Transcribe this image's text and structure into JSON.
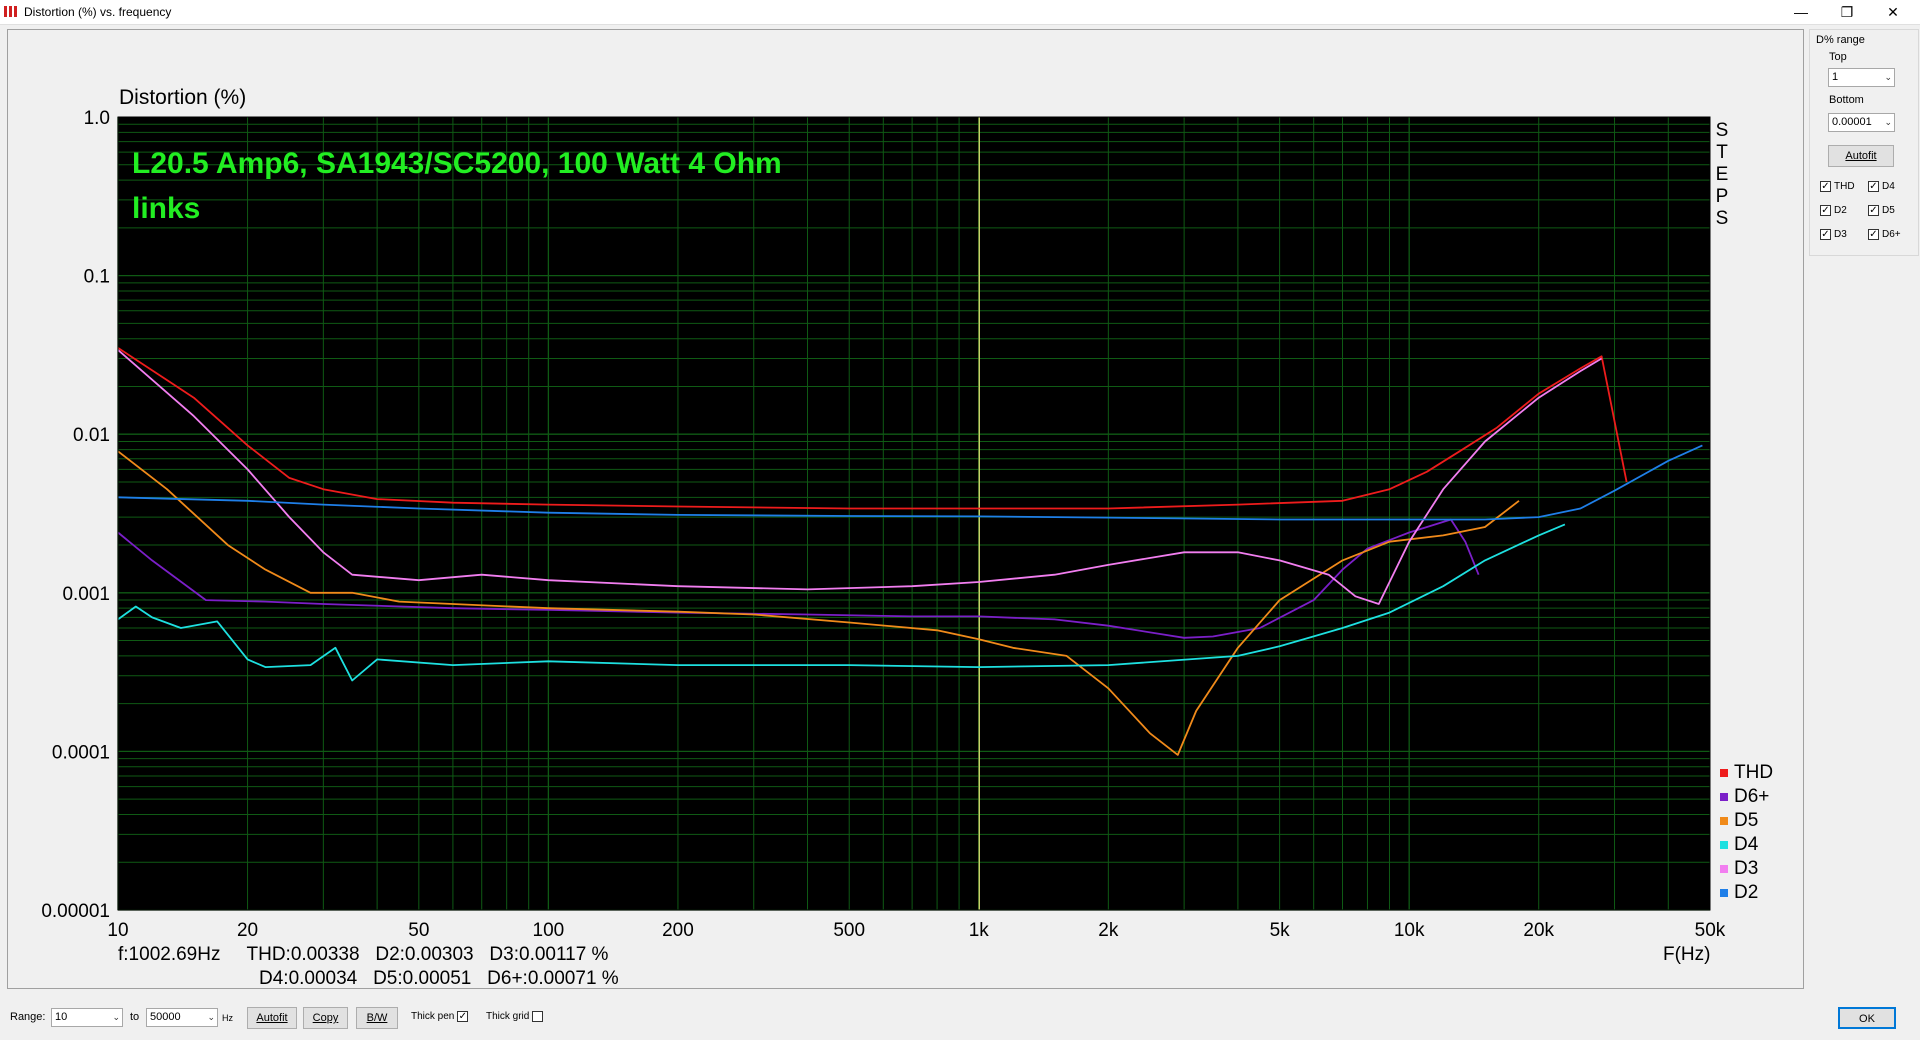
{
  "window": {
    "title": "Distortion (%) vs. frequency",
    "minimize": "—",
    "restore": "❐",
    "close": "✕"
  },
  "panel": {
    "range_title": "D% range",
    "top_label": "Top",
    "top_value": "1",
    "bottom_label": "Bottom",
    "bottom_value": "0.00001",
    "autofit": "Autofit",
    "checks": [
      {
        "label": "THD",
        "checked": true
      },
      {
        "label": "D4",
        "checked": true
      },
      {
        "label": "D2",
        "checked": true
      },
      {
        "label": "D5",
        "checked": true
      },
      {
        "label": "D3",
        "checked": true
      },
      {
        "label": "D6+",
        "checked": true
      }
    ]
  },
  "bottom": {
    "range_label": "Range:",
    "range_from": "10",
    "to_label": "to",
    "range_to": "50000",
    "hz_label": "Hz",
    "autofit": "Autofit",
    "copy": "Copy",
    "bw": "B/W",
    "thick_pen": "Thick pen",
    "thick_pen_checked": true,
    "thick_grid": "Thick grid",
    "thick_grid_checked": false,
    "ok": "OK"
  },
  "readout": {
    "line1": "f:1002.69Hz     THD:0.00338   D2:0.00303   D3:0.00117 %",
    "line2": "D4:0.00034   D5:0.00051   D6+:0.00071 %"
  },
  "chart_data": {
    "type": "line",
    "ylabel": "Distortion (%)",
    "xlabel": "F(Hz)",
    "annotation": [
      "L20.5 Amp6, SA1943/SC5200, 100 Watt 4 Ohm",
      "links"
    ],
    "side_label": "STEPS",
    "xscale": "log",
    "yscale": "log",
    "xlim": [
      10,
      50000
    ],
    "ylim": [
      1e-05,
      1
    ],
    "xticks": [
      {
        "v": 10,
        "label": "10"
      },
      {
        "v": 20,
        "label": "20"
      },
      {
        "v": 50,
        "label": "50"
      },
      {
        "v": 100,
        "label": "100"
      },
      {
        "v": 200,
        "label": "200"
      },
      {
        "v": 500,
        "label": "500"
      },
      {
        "v": 1000,
        "label": "1k"
      },
      {
        "v": 2000,
        "label": "2k"
      },
      {
        "v": 5000,
        "label": "5k"
      },
      {
        "v": 10000,
        "label": "10k"
      },
      {
        "v": 20000,
        "label": "20k"
      },
      {
        "v": 50000,
        "label": "50k"
      }
    ],
    "yticks": [
      {
        "v": 1,
        "label": "1.0"
      },
      {
        "v": 0.1,
        "label": "0.1"
      },
      {
        "v": 0.01,
        "label": "0.01"
      },
      {
        "v": 0.001,
        "label": "0.001"
      },
      {
        "v": 0.0001,
        "label": "0.0001"
      },
      {
        "v": 1e-05,
        "label": "0.00001"
      }
    ],
    "cursor_x": 1002.69,
    "grid": true,
    "legend_position": "bottom-right",
    "colors": {
      "background": "#000000",
      "grid": "#0f5a14",
      "cursor": "#cfd26a",
      "annotation": "#22ee22"
    },
    "series": [
      {
        "name": "THD",
        "color": "#ee1c1c",
        "points": [
          [
            10,
            0.035
          ],
          [
            15,
            0.017
          ],
          [
            20,
            0.0085
          ],
          [
            25,
            0.0053
          ],
          [
            30,
            0.0045
          ],
          [
            40,
            0.0039
          ],
          [
            60,
            0.0037
          ],
          [
            100,
            0.0036
          ],
          [
            200,
            0.0035
          ],
          [
            500,
            0.0034
          ],
          [
            1000,
            0.0034
          ],
          [
            2000,
            0.0034
          ],
          [
            4000,
            0.0036
          ],
          [
            7000,
            0.0038
          ],
          [
            9000,
            0.0045
          ],
          [
            11000,
            0.0058
          ],
          [
            13000,
            0.0077
          ],
          [
            16000,
            0.011
          ],
          [
            20000,
            0.018
          ],
          [
            25000,
            0.026
          ],
          [
            28000,
            0.031
          ],
          [
            32000,
            0.005
          ]
        ]
      },
      {
        "name": "D6+",
        "color": "#7b1fc8",
        "points": [
          [
            10,
            0.0024
          ],
          [
            12,
            0.0016
          ],
          [
            16,
            0.0009
          ],
          [
            22,
            0.00088
          ],
          [
            30,
            0.00085
          ],
          [
            60,
            0.0008
          ],
          [
            100,
            0.00078
          ],
          [
            200,
            0.00075
          ],
          [
            400,
            0.00073
          ],
          [
            700,
            0.00071
          ],
          [
            1000,
            0.00071
          ],
          [
            1500,
            0.00068
          ],
          [
            2000,
            0.00062
          ],
          [
            3000,
            0.00052
          ],
          [
            3500,
            0.00053
          ],
          [
            4500,
            0.0006
          ],
          [
            6000,
            0.0009
          ],
          [
            7000,
            0.0014
          ],
          [
            8000,
            0.0019
          ],
          [
            10000,
            0.0024
          ],
          [
            11000,
            0.0026
          ],
          [
            12500,
            0.0029
          ],
          [
            13500,
            0.0021
          ],
          [
            14500,
            0.0013
          ]
        ]
      },
      {
        "name": "D5",
        "color": "#f08a1a",
        "points": [
          [
            10,
            0.0078
          ],
          [
            13,
            0.0045
          ],
          [
            18,
            0.002
          ],
          [
            22,
            0.0014
          ],
          [
            28,
            0.001
          ],
          [
            35,
            0.001
          ],
          [
            45,
            0.00088
          ],
          [
            60,
            0.00085
          ],
          [
            100,
            0.0008
          ],
          [
            200,
            0.00076
          ],
          [
            300,
            0.00073
          ],
          [
            500,
            0.00065
          ],
          [
            800,
            0.00058
          ],
          [
            1000,
            0.00051
          ],
          [
            1200,
            0.00045
          ],
          [
            1600,
            0.0004
          ],
          [
            2000,
            0.00025
          ],
          [
            2500,
            0.00013
          ],
          [
            2900,
            9.5e-05
          ],
          [
            3200,
            0.00018
          ],
          [
            4000,
            0.00045
          ],
          [
            5000,
            0.0009
          ],
          [
            7000,
            0.0016
          ],
          [
            9000,
            0.0021
          ],
          [
            12000,
            0.0023
          ],
          [
            15000,
            0.0026
          ],
          [
            18000,
            0.0038
          ]
        ]
      },
      {
        "name": "D4",
        "color": "#1ee0e0",
        "points": [
          [
            10,
            0.00068
          ],
          [
            11,
            0.00082
          ],
          [
            12,
            0.0007
          ],
          [
            14,
            0.0006
          ],
          [
            17,
            0.00066
          ],
          [
            20,
            0.00038
          ],
          [
            22,
            0.00034
          ],
          [
            28,
            0.00035
          ],
          [
            32,
            0.00045
          ],
          [
            35,
            0.00028
          ],
          [
            40,
            0.00038
          ],
          [
            60,
            0.00035
          ],
          [
            100,
            0.00037
          ],
          [
            200,
            0.00035
          ],
          [
            500,
            0.00035
          ],
          [
            1000,
            0.00034
          ],
          [
            2000,
            0.00035
          ],
          [
            4000,
            0.0004
          ],
          [
            5000,
            0.00046
          ],
          [
            7000,
            0.0006
          ],
          [
            9000,
            0.00075
          ],
          [
            12000,
            0.0011
          ],
          [
            15000,
            0.0016
          ],
          [
            20000,
            0.0023
          ],
          [
            23000,
            0.0027
          ]
        ]
      },
      {
        "name": "D3",
        "color": "#f27ef0",
        "points": [
          [
            10,
            0.034
          ],
          [
            15,
            0.013
          ],
          [
            20,
            0.006
          ],
          [
            25,
            0.003
          ],
          [
            30,
            0.0018
          ],
          [
            35,
            0.0013
          ],
          [
            50,
            0.0012
          ],
          [
            70,
            0.0013
          ],
          [
            100,
            0.0012
          ],
          [
            200,
            0.0011
          ],
          [
            400,
            0.00105
          ],
          [
            700,
            0.0011
          ],
          [
            1000,
            0.00117
          ],
          [
            1500,
            0.0013
          ],
          [
            2000,
            0.0015
          ],
          [
            3000,
            0.0018
          ],
          [
            4000,
            0.0018
          ],
          [
            5000,
            0.0016
          ],
          [
            6500,
            0.0013
          ],
          [
            7500,
            0.00095
          ],
          [
            8500,
            0.00085
          ],
          [
            10000,
            0.0021
          ],
          [
            12000,
            0.0045
          ],
          [
            15000,
            0.009
          ],
          [
            20000,
            0.017
          ],
          [
            25000,
            0.025
          ],
          [
            28000,
            0.03
          ]
        ]
      },
      {
        "name": "D2",
        "color": "#1f7fe8",
        "points": [
          [
            10,
            0.004
          ],
          [
            20,
            0.0038
          ],
          [
            30,
            0.0036
          ],
          [
            50,
            0.0034
          ],
          [
            100,
            0.0032
          ],
          [
            200,
            0.0031
          ],
          [
            500,
            0.00305
          ],
          [
            1000,
            0.00303
          ],
          [
            2000,
            0.00298
          ],
          [
            5000,
            0.0029
          ],
          [
            10000,
            0.0029
          ],
          [
            15000,
            0.0029
          ],
          [
            20000,
            0.003
          ],
          [
            25000,
            0.0034
          ],
          [
            30000,
            0.0044
          ],
          [
            40000,
            0.0068
          ],
          [
            48000,
            0.0085
          ]
        ]
      }
    ]
  }
}
